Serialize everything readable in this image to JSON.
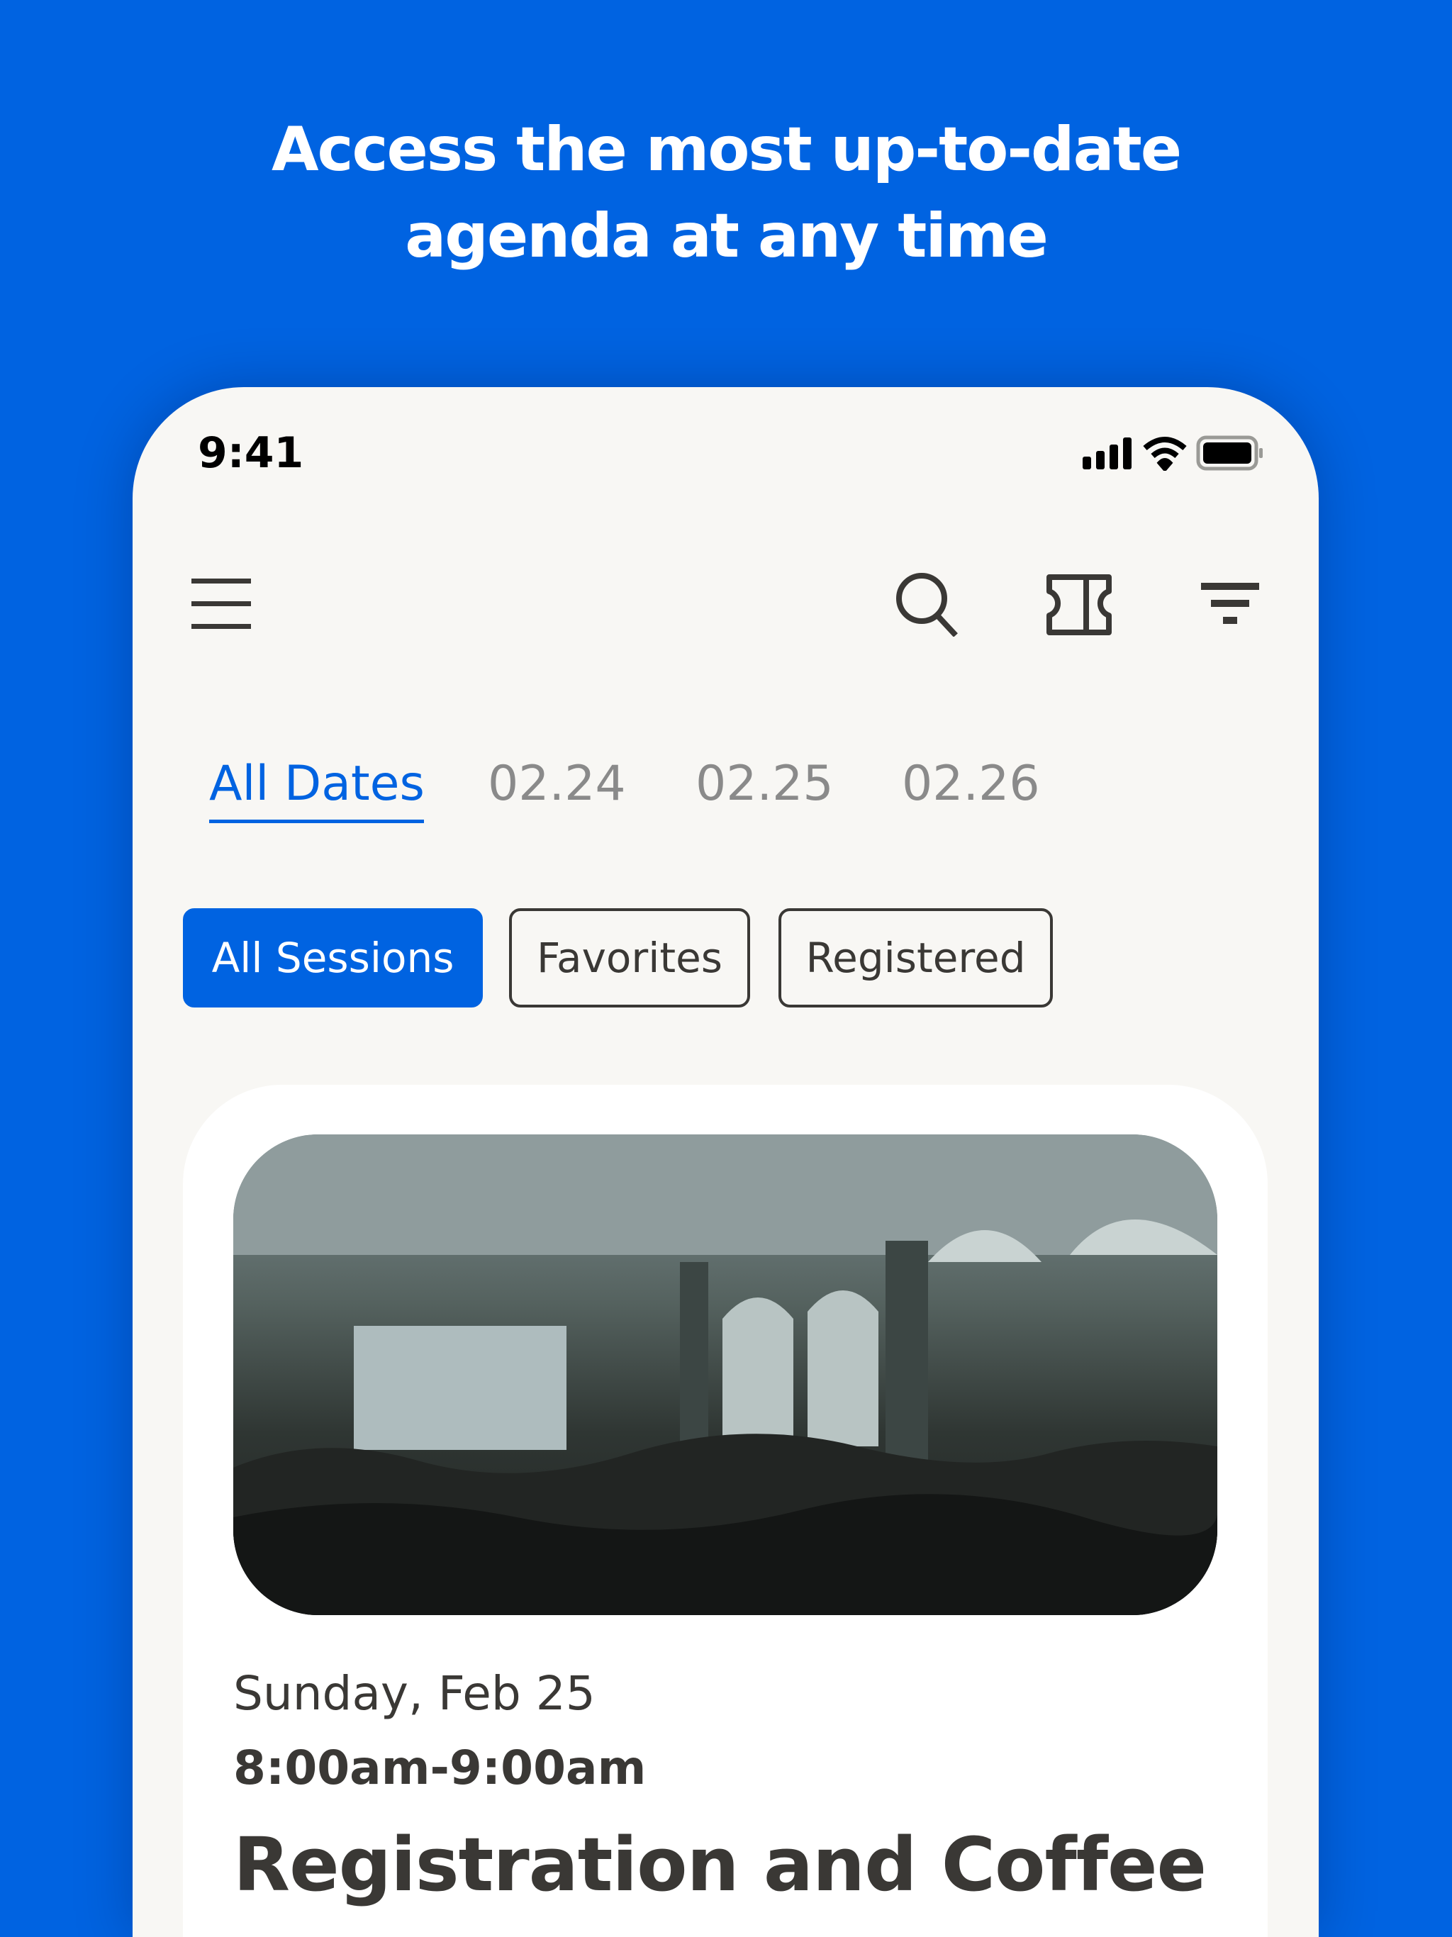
{
  "headline": {
    "line1": "Access the most up-to-date",
    "line2": "agenda at any time"
  },
  "status_bar": {
    "time": "9:41",
    "icons": [
      "signal-icon",
      "wifi-icon",
      "battery-icon"
    ]
  },
  "toolbar": {
    "icons": [
      "menu-icon",
      "search-icon",
      "ticket-icon",
      "filter-icon"
    ]
  },
  "date_tabs": [
    {
      "label": "All Dates",
      "active": true
    },
    {
      "label": "02.24"
    },
    {
      "label": "02.25"
    },
    {
      "label": "02.26"
    }
  ],
  "session_filters": [
    {
      "label": "All Sessions",
      "active": true
    },
    {
      "label": "Favorites"
    },
    {
      "label": "Registered"
    }
  ],
  "session_card": {
    "date": "Sunday, Feb 25",
    "time": "8:00am-9:00am",
    "title": "Registration and Coffee"
  },
  "colors": {
    "brand": "#0063e1",
    "background": "#f8f7f4",
    "text": "#3a3835",
    "inactive_tab": "#8a8a8a"
  }
}
